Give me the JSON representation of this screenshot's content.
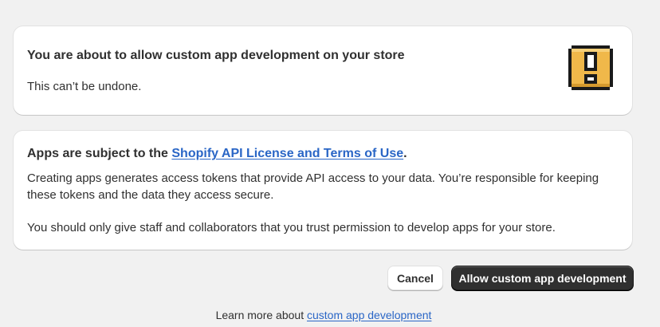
{
  "card1": {
    "title": "You are about to allow custom app development on your store",
    "body": "This can’t be undone.",
    "icon": "exclamation-warning-icon"
  },
  "card2": {
    "title_prefix": "Apps are subject to the ",
    "title_link": "Shopify API License and Terms of Use",
    "title_suffix": ".",
    "paragraph1": "Creating apps generates access tokens that provide API access to your data. You’re responsible for keeping these tokens and the data they access secure.",
    "paragraph2": "You should only give staff and collaborators that you trust permission to develop apps for your store."
  },
  "actions": {
    "cancel_label": "Cancel",
    "allow_label": "Allow custom app development"
  },
  "footer": {
    "prefix": "Learn more about ",
    "link": "custom app development"
  },
  "colors": {
    "background": "#f1f1f1",
    "card": "#ffffff",
    "text": "#303030",
    "link": "#2a66c6",
    "primary_button": "#303030",
    "warning_icon": "#f0b84a"
  }
}
